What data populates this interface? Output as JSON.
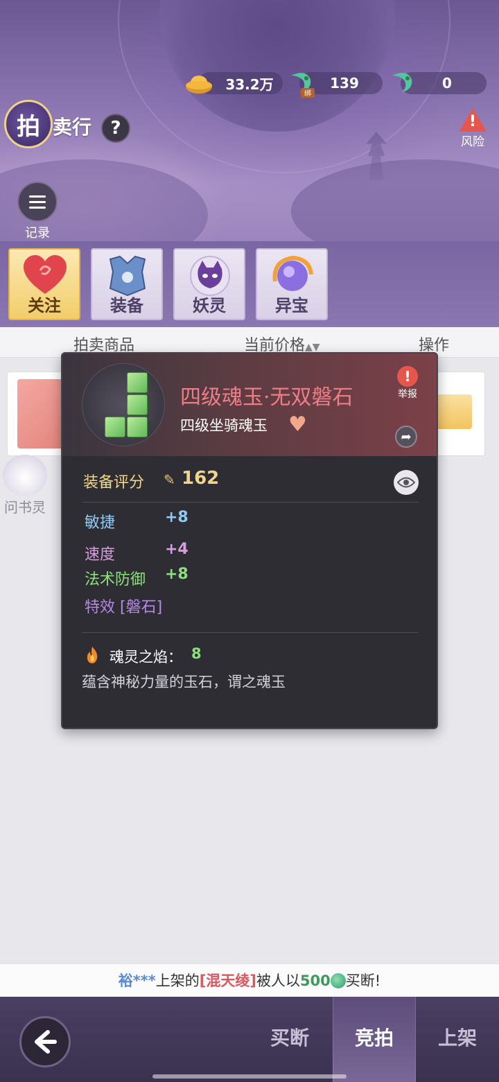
{
  "currency": {
    "gold": "33.2万",
    "bound_jade": "139",
    "bound_badge": "绑",
    "jade": "0"
  },
  "header": {
    "logo_char": "拍",
    "title": "卖行",
    "help_label": "?",
    "risk_label": "风险",
    "records_label": "记录"
  },
  "categories": [
    {
      "label": "关注"
    },
    {
      "label": "装备"
    },
    {
      "label": "妖灵"
    },
    {
      "label": "异宝"
    }
  ],
  "table": {
    "col_item": "拍卖商品",
    "col_price": "当前价格",
    "col_action": "操作"
  },
  "helper": {
    "label": "问书灵"
  },
  "popup": {
    "item_name": "四级魂玉·无双磐石",
    "item_type": "四级坐骑魂玉",
    "report_label": "举报",
    "score_label": "装备评分",
    "score_value": "162",
    "attributes": [
      {
        "name": "敏捷",
        "value": "+8"
      },
      {
        "name": "速度",
        "value": "+4"
      },
      {
        "name": "法术防御",
        "value": "+8"
      },
      {
        "name": "特效 [磐石]",
        "value": ""
      }
    ],
    "soul_label": "魂灵之焰：",
    "soul_value": "8",
    "description": "蕴含神秘力量的玉石，谓之魂玉"
  },
  "ticker": {
    "user": "裕***",
    "text1": "上架的",
    "item": "[混天绫]",
    "text2": "被人以",
    "price": "500",
    "text3": "买断!"
  },
  "bottom_nav": {
    "buyout": "买断",
    "bid": "竞拍",
    "list": "上架"
  },
  "colors": {
    "item_name": "#ee7d86",
    "score": "#f0d68a",
    "attr_blue": "#8ecbf2",
    "attr_pink": "#d99be2",
    "attr_green": "#8ee07e",
    "attr_purple": "#b48ae6"
  }
}
